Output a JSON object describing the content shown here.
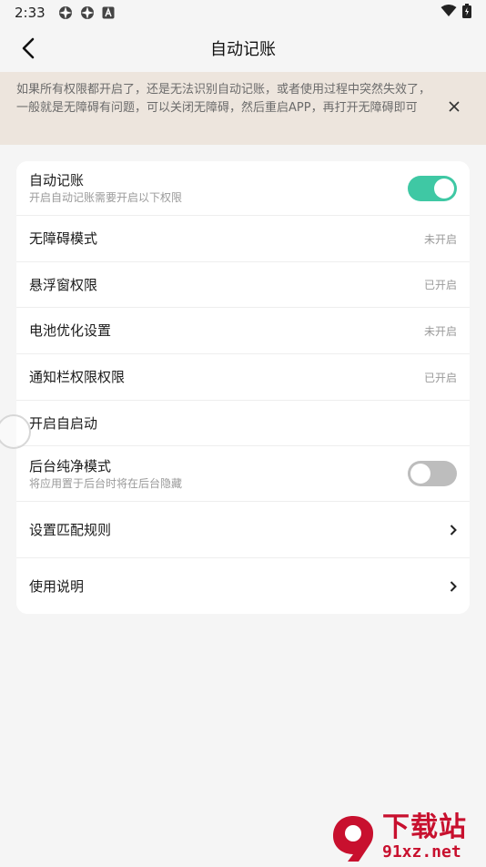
{
  "status_bar": {
    "time": "2:33",
    "left_icons": [
      "pinwheel-icon",
      "pinwheel-icon",
      "a-icon"
    ],
    "right_icons": [
      "wifi-icon",
      "battery-icon"
    ]
  },
  "app_bar": {
    "title": "自动记账",
    "back_icon": "back-arrow-icon"
  },
  "notice": {
    "text": "如果所有权限都开启了，还是无法识别自动记账，或者使用过程中突然失效了，一般就是无障碍有问题，可以关闭无障碍，然后重启APP，再打开无障碍即可",
    "close_icon": "close-icon"
  },
  "settings": [
    {
      "label": "自动记账",
      "sub": "开启自动记账需要开启以下权限",
      "control": "toggle",
      "toggle_on": true
    },
    {
      "label": "无障碍模式",
      "status": "未开启"
    },
    {
      "label": "悬浮窗权限",
      "status": "已开启"
    },
    {
      "label": "电池优化设置",
      "status": "未开启"
    },
    {
      "label": "通知栏权限权限",
      "status": "已开启"
    },
    {
      "label": "开启自启动"
    },
    {
      "label": "后台纯净模式",
      "sub": "将应用置于后台时将在后台隐藏",
      "control": "toggle",
      "toggle_on": false
    },
    {
      "label": "设置匹配规则",
      "control": "chevron"
    },
    {
      "label": "使用说明",
      "control": "chevron"
    }
  ],
  "colors": {
    "accent": "#3fc8a4",
    "notice_bg": "#ede5dd",
    "page_bg": "#f5f5f5",
    "toggle_off": "#bdbdbd",
    "watermark": "#c8102e"
  },
  "watermark": {
    "title": "下载站",
    "url": "91xz.net"
  }
}
